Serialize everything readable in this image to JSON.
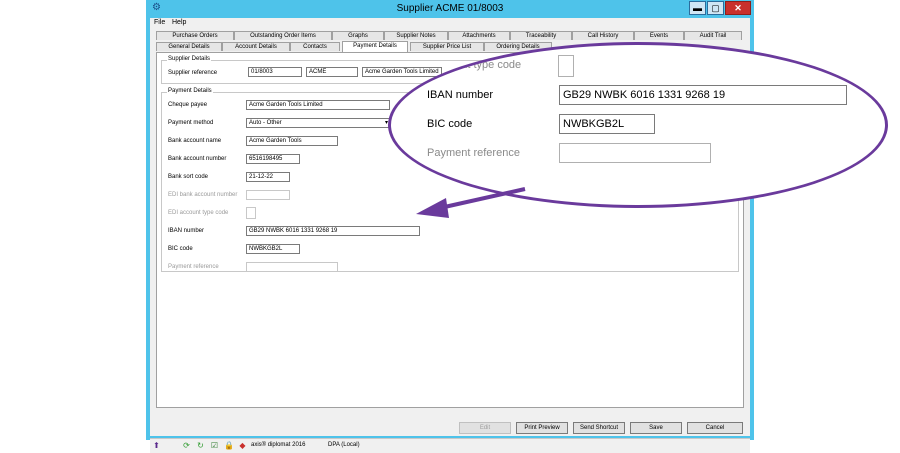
{
  "window": {
    "title": "Supplier ACME 01/8003",
    "min": "▬",
    "max": "▢",
    "close": "✕"
  },
  "menu": [
    "File",
    "Help"
  ],
  "tabs_row1": [
    "Purchase Orders",
    "Outstanding Order Items",
    "Graphs",
    "Supplier Notes",
    "Attachments",
    "Traceability",
    "Call History",
    "Events",
    "Audit Trail"
  ],
  "tabs_row2": [
    "General Details",
    "Account Details",
    "Contacts",
    "Payment Details",
    "Supplier Price List",
    "Ordering Details"
  ],
  "active_tab": "Payment Details",
  "supplier_details": {
    "title": "Supplier Details",
    "ref_label": "Supplier reference",
    "ref_code": "01/8003",
    "ref_short": "ACME",
    "ref_name": "Acme Garden Tools Limited"
  },
  "payment_details": {
    "title": "Payment Details",
    "cheque_payee_label": "Cheque payee",
    "cheque_payee": "Acme Garden Tools Limited",
    "method_label": "Payment method",
    "method": "Auto - Other",
    "bank_name_label": "Bank account name",
    "bank_name": "Acme Garden Tools",
    "bank_number_label": "Bank account number",
    "bank_number": "6516198495",
    "sort_code_label": "Bank sort code",
    "sort_code": "21-12-22",
    "edi_number_label": "EDI bank account number",
    "edi_type_label": "EDI account type code",
    "iban_label": "IBAN number",
    "iban": "GB29 NWBK 6016 1331 9268 19",
    "bic_label": "BIC code",
    "bic": "NWBKGB2L",
    "payref_label": "Payment reference"
  },
  "buttons": {
    "edit": "Edit",
    "print_preview": "Print Preview",
    "send_shortcut": "Send Shortcut",
    "save": "Save",
    "cancel": "Cancel"
  },
  "status": {
    "product": "axis® diplomat 2016",
    "db": "DPA (Local)"
  },
  "callout": {
    "edi_type_label": "ount type code",
    "iban_label": "IBAN number",
    "iban": "GB29 NWBK 6016 1331 9268 19",
    "bic_label": "BIC code",
    "bic": "NWBKGB2L",
    "payref_label": "Payment reference"
  },
  "colors": {
    "title_bar": "#4ec3ea",
    "callout_border": "#6a3a9c",
    "close_button": "#c9302c"
  }
}
